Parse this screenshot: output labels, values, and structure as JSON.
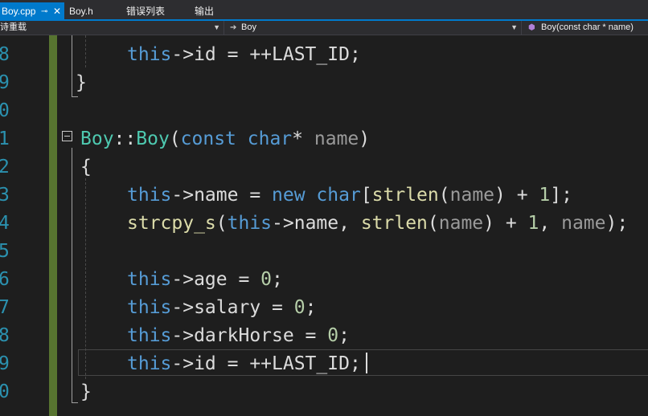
{
  "tabs": [
    {
      "label": "Boy.cpp",
      "pin_icon": "pin-icon",
      "close_icon": "close-icon",
      "active": true
    },
    {
      "label": "Boy.h"
    },
    {
      "label": "错误列表"
    },
    {
      "label": "输出"
    }
  ],
  "nav": {
    "scope_label": "诗重载",
    "class_label": "Boy",
    "member_label": "Boy(const char * name)"
  },
  "line_numbers": [
    "8",
    "9",
    "0",
    "1",
    "2",
    "3",
    "4",
    "5",
    "6",
    "7",
    "8",
    "9",
    "0"
  ],
  "code": {
    "l0_this": "this",
    "l0_rest": "->id = ++LAST_ID;",
    "l1": "}",
    "l3_class": "Boy",
    "l3_scope": "::",
    "l3_ctor": "Boy",
    "l3_paren": "(",
    "l3_const": "const",
    "l3_char": "char",
    "l3_star": "*",
    "l3_param": "name",
    "l3_close": ")",
    "l4": "{",
    "l5_this": "this",
    "l5_a": "->name = ",
    "l5_new": "new",
    "l5_char": "char",
    "l5_b": "[",
    "l5_fn": "strlen",
    "l5_c": "(",
    "l5_param": "name",
    "l5_d": ") + ",
    "l5_num": "1",
    "l5_e": "];",
    "l6_fn": "strcpy_s",
    "l6_a": "(",
    "l6_this": "this",
    "l6_b": "->name, ",
    "l6_fn2": "strlen",
    "l6_c": "(",
    "l6_param": "name",
    "l6_d": ") + ",
    "l6_num": "1",
    "l6_e": ", ",
    "l6_param2": "name",
    "l6_f": ");",
    "l8_this": "this",
    "l8_rest": "->age = ",
    "l8_num": "0",
    "l8_end": ";",
    "l9_this": "this",
    "l9_rest": "->salary = ",
    "l9_num": "0",
    "l9_end": ";",
    "l10_this": "this",
    "l10_rest": "->darkHorse = ",
    "l10_num": "0",
    "l10_end": ";",
    "l11_this": "this",
    "l11_rest": "->id = ++LAST_ID;",
    "l12": "}"
  }
}
